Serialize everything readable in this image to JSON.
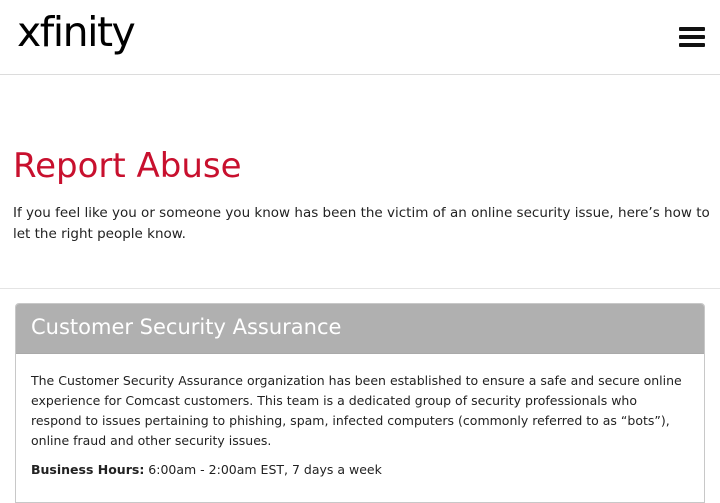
{
  "header": {
    "logo_text": "xfinity",
    "menu_icon": "hamburger-menu-icon"
  },
  "page": {
    "title": "Report Abuse",
    "intro": "If you feel like you or someone you know has been the victim of an online security issue, here’s how to let the right people know."
  },
  "panel": {
    "title": "Customer Security Assurance",
    "description": "The Customer Security Assurance organization has been established to ensure a safe and secure online experience for Comcast customers. This team is a dedicated group of security professionals who respond to issues pertaining to phishing, spam, infected computers (commonly referred to as “bots”), online fraud and other security issues.",
    "hours_label": "Business Hours:",
    "hours_value": "6:00am - 2:00am EST, 7 days a week"
  },
  "colors": {
    "title_red": "#c8102e",
    "panel_header_gray": "#b0b0b0",
    "text": "#222222"
  }
}
